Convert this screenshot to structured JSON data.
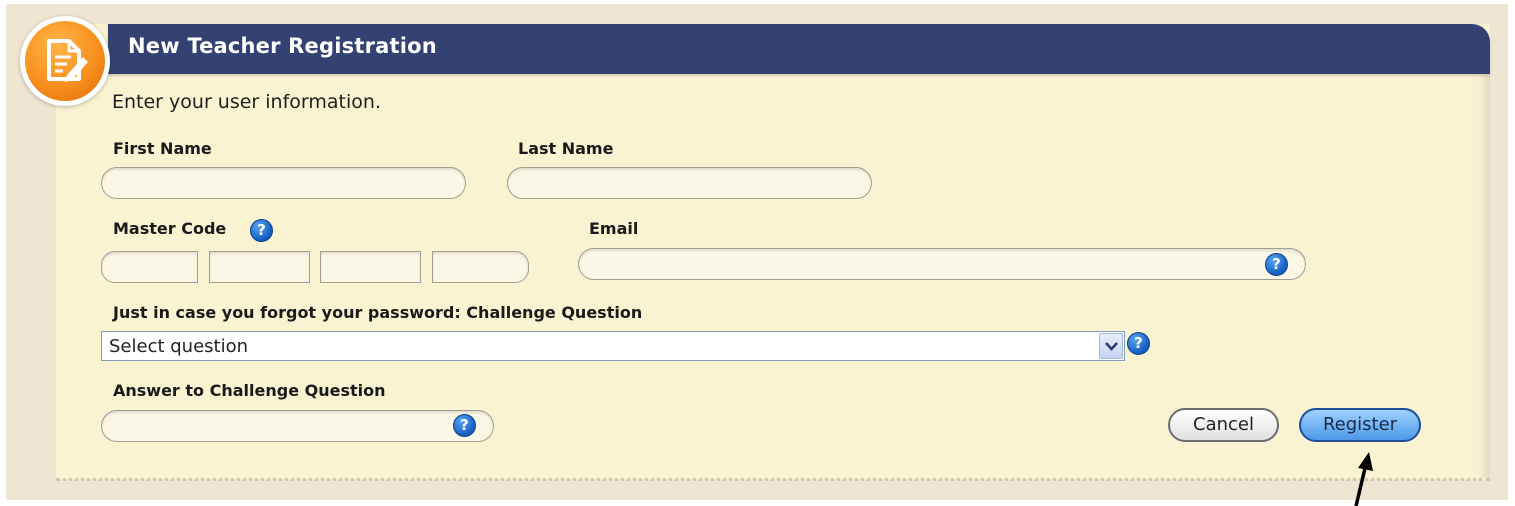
{
  "header": {
    "title": "New Teacher Registration",
    "icon": "document-edit-icon"
  },
  "intro_text": "Enter your user information.",
  "fields": {
    "first_name": {
      "label": "First Name",
      "value": ""
    },
    "last_name": {
      "label": "Last Name",
      "value": ""
    },
    "master_code": {
      "label": "Master Code",
      "segments": [
        "",
        "",
        "",
        ""
      ]
    },
    "email": {
      "label": "Email",
      "value": ""
    },
    "challenge_question": {
      "label": "Just in case you forgot your password: Challenge Question",
      "selected": "Select question"
    },
    "challenge_answer": {
      "label": "Answer to Challenge Question",
      "value": ""
    }
  },
  "help_glyph": "?",
  "buttons": {
    "cancel": "Cancel",
    "register": "Register"
  },
  "colors": {
    "header_bg": "#334272",
    "panel_bg": "#f9f3d2",
    "badge_orange": "#f7901e",
    "help_blue": "#1c66c9",
    "register_blue": "#4d98e8"
  }
}
